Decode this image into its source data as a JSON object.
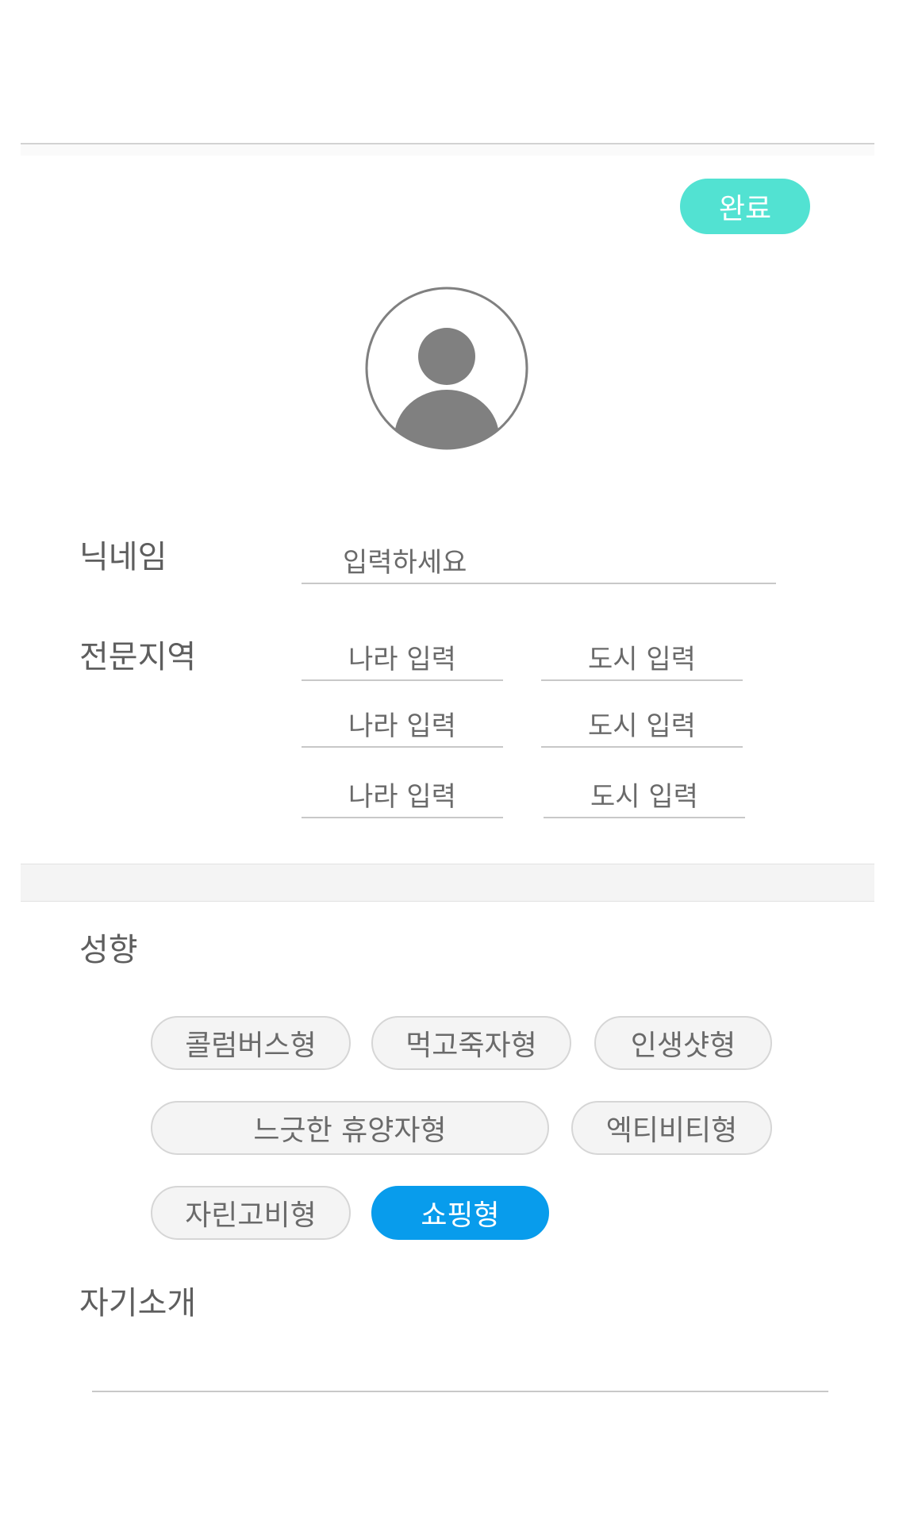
{
  "header": {
    "done_label": "완료"
  },
  "profile": {
    "avatar_icon": "user-avatar-icon",
    "nickname": {
      "label": "닉네임",
      "placeholder": "입력하세요",
      "value": ""
    },
    "expertise_region": {
      "label": "전문지역",
      "rows": [
        {
          "country_placeholder": "나라 입력",
          "city_placeholder": "도시 입력"
        },
        {
          "country_placeholder": "나라 입력",
          "city_placeholder": "도시 입력"
        },
        {
          "country_placeholder": "나라 입력",
          "city_placeholder": "도시 입력"
        }
      ]
    }
  },
  "tendency": {
    "label": "성향",
    "options": [
      {
        "label": "콜럼버스형",
        "selected": false
      },
      {
        "label": "먹고죽자형",
        "selected": false
      },
      {
        "label": "인생샷형",
        "selected": false
      },
      {
        "label": "느긋한 휴양자형",
        "selected": false
      },
      {
        "label": "엑티비티형",
        "selected": false
      },
      {
        "label": "자린고비형",
        "selected": false
      },
      {
        "label": "쇼핑형",
        "selected": true
      }
    ]
  },
  "introduction": {
    "label": "자기소개",
    "value": ""
  },
  "colors": {
    "done_button": "#52e2d2",
    "selected_chip": "#089cec",
    "chip_background": "#f4f4f4"
  }
}
